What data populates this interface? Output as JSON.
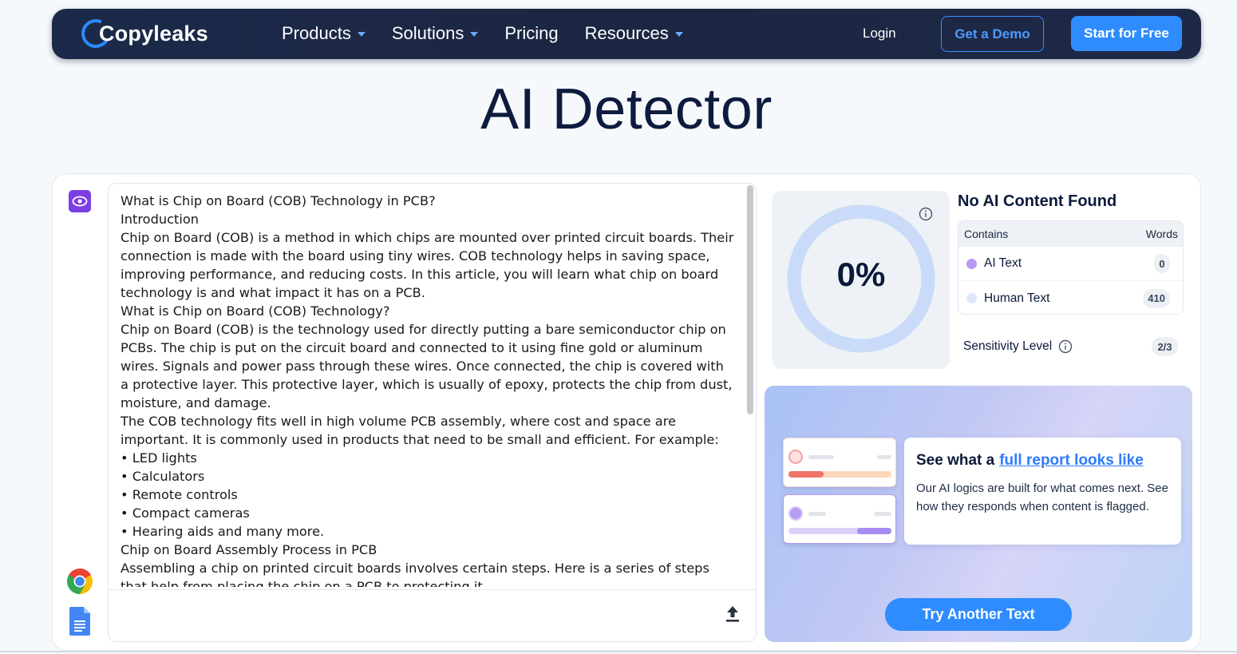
{
  "nav": {
    "logo_text": "Copyleaks",
    "menu": [
      {
        "label": "Products",
        "has_caret": true
      },
      {
        "label": "Solutions",
        "has_caret": true
      },
      {
        "label": "Pricing",
        "has_caret": false
      },
      {
        "label": "Resources",
        "has_caret": true
      }
    ],
    "login": "Login",
    "demo_button": "Get a Demo",
    "free_button": "Start for Free"
  },
  "page_title": "AI Detector",
  "editor": {
    "paragraphs": [
      "What is Chip on Board (COB) Technology in PCB?",
      "Introduction",
      "Chip on Board (COB) is a method in which chips are mounted over printed circuit boards. Their connection is made with the board using tiny wires. COB technology helps in saving space, improving performance, and reducing costs. In this article, you will learn what chip on board technology is and what impact it has on a PCB.",
      "What is Chip on Board (COB) Technology?",
      "Chip on Board (COB) is the technology used for directly putting a bare semiconductor chip on PCBs. The chip is put on the circuit board and connected to it using fine gold or aluminum wires. Signals and power pass through these wires. Once connected, the chip is covered with a protective layer. This protective layer, which is usually of epoxy, protects the chip from dust, moisture, and damage.",
      "The COB technology fits well in high volume PCB assembly, where cost and space are important. It is commonly used in products that need to be small and efficient. For example:",
      "• LED lights",
      "• Calculators",
      "• Remote controls",
      "• Compact cameras",
      "• Hearing aids and many more.",
      "Chip on Board Assembly Process in PCB",
      "Assembling a chip on printed circuit boards involves certain steps. Here is a series of steps that help from placing the chip on a PCB to protecting it."
    ],
    "icons": [
      "eye-icon",
      "chrome-icon",
      "google-docs-icon",
      "upload-icon"
    ]
  },
  "result": {
    "percentage": "0%",
    "percentage_value": 0,
    "title": "No AI Content Found",
    "table_header": {
      "left": "Contains",
      "right": "Words"
    },
    "rows": [
      {
        "label": "AI Text",
        "count": "0",
        "dot_color": "#b69af0"
      },
      {
        "label": "Human Text",
        "count": "410",
        "dot_color": "#dde8fb"
      }
    ],
    "sensitivity_label": "Sensitivity Level",
    "sensitivity_value": "2/3"
  },
  "promo": {
    "heading_prefix": "See what a",
    "heading_link": "full report looks like",
    "description": "Our AI logics are built for what comes next. See how they responds when content is flagged.",
    "button": "Try Another Text"
  },
  "colors": {
    "accent": "#2e8cff",
    "nav_bg": "#1b2a4a",
    "gauge_ring": "#c8daf7",
    "ai_purple": "#7b3fe4"
  }
}
